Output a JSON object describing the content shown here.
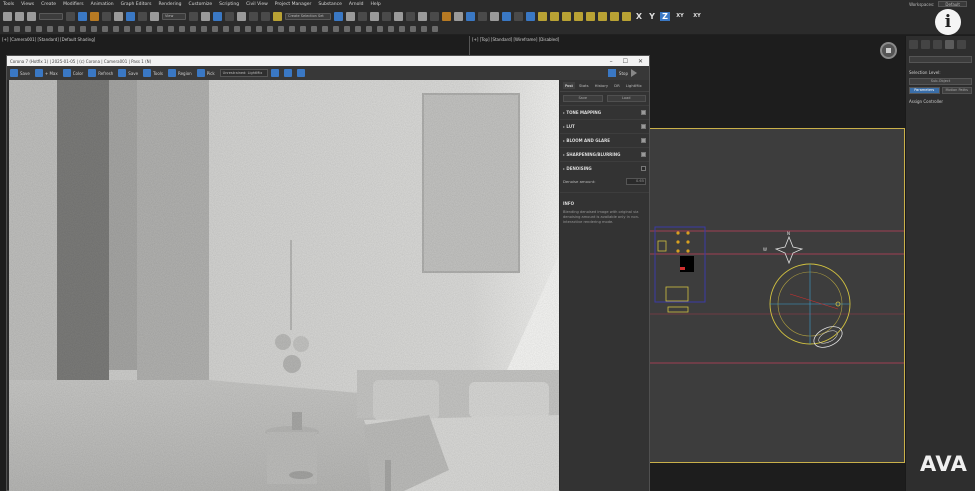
{
  "menu": [
    "Tools",
    "Views",
    "Create",
    "Modifiers",
    "Animation",
    "Graph Editors",
    "Rendering",
    "Customize",
    "Scripting",
    "Civil View",
    "Project Manager",
    "Substance",
    "Arnold",
    "Help"
  ],
  "workspace": {
    "label": "Workspaces:",
    "value": "Default"
  },
  "toolbar": {
    "view_dropdown": "View",
    "selection_set": "Create Selection Set",
    "axes": {
      "x": "X",
      "y": "Y",
      "z": "Z",
      "xy": "XY",
      "xy2": "XY"
    }
  },
  "viewports": {
    "left_label": "[+] [Camera001] [Standard] [Default Shading]",
    "top_label": "[+] [Top] [Standard] [Wireframe] [Disabled]"
  },
  "frame_buffer": {
    "title": "Corona 7 (Hotfix 1) | 2025-01-05 | (c) Corona | Camera001 | Pass 1 (N)",
    "window_controls": [
      "–",
      "☐",
      "✕"
    ],
    "toolbar": [
      "Save",
      "+ Max",
      "Color",
      "Refresh",
      "Save",
      "Tools",
      "Region",
      "Pick"
    ],
    "denoiser": "Unrestrained: LightMix",
    "stop_label": "Stop",
    "panel_tabs": [
      "Post",
      "Stats",
      "History",
      "DR",
      "LightMix"
    ],
    "panel_subtabs": [
      "Save",
      "Load"
    ],
    "sections": [
      {
        "label": "TONE MAPPING",
        "checked": true
      },
      {
        "label": "LUT",
        "checked": true
      },
      {
        "label": "BLOOM AND GLARE",
        "checked": true
      },
      {
        "label": "SHARPENING/BLURRING",
        "checked": true
      },
      {
        "label": "DENOISING",
        "checked": false
      }
    ],
    "denoise_amount_label": "Denoise amount:",
    "denoise_amount_value": "0.65",
    "info_title": "INFO",
    "info_text": "Blending denoised image with original via denoising amount is available only in non-interactive rendering mode."
  },
  "command_panel": {
    "selection_level": "Selection Level:",
    "buttons": [
      "Sub-Object",
      "Parameters",
      "Motion Paths"
    ],
    "assign_controller": "Assign Controller"
  },
  "info_badge": "i",
  "logo": "AVA",
  "colors": {
    "accent": "#3a78c4",
    "viewport_border": "#c9b04a",
    "panel_bg": "#333333",
    "title_bar": "#f2f2f2"
  }
}
